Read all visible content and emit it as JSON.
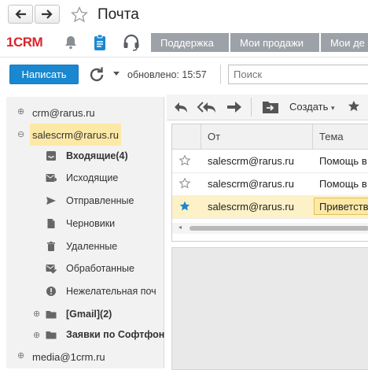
{
  "window": {
    "title": "Почта"
  },
  "menu": {
    "tabs": [
      "Поддержка",
      "Мои продажи",
      "Мои де"
    ]
  },
  "toolbar": {
    "compose_label": "Написать",
    "updated_label": "обновлено: 15:57",
    "search_placeholder": "Поиск"
  },
  "logo": {
    "text": "1CRM"
  },
  "sidebar": {
    "accounts": [
      {
        "label": "crm@rarus.ru"
      },
      {
        "label": "salescrm@rarus.ru"
      },
      {
        "label": "media@1crm.ru"
      }
    ],
    "folders": [
      {
        "label": "Входящие(4)",
        "icon": "inbox-icon",
        "bold": true
      },
      {
        "label": "Исходящие",
        "icon": "outbox-icon"
      },
      {
        "label": "Отправленные",
        "icon": "send-icon"
      },
      {
        "label": "Черновики",
        "icon": "draft-icon"
      },
      {
        "label": "Удаленные",
        "icon": "trash-icon"
      },
      {
        "label": "Обработанные",
        "icon": "processed-icon"
      },
      {
        "label": "Нежелательная поч",
        "icon": "spam-icon"
      },
      {
        "label": "[Gmail](2)",
        "icon": "folder-icon",
        "bold": true
      },
      {
        "label": "Заявки по Софтфон",
        "icon": "folder-icon",
        "bold": true
      }
    ]
  },
  "mail_toolbar": {
    "create_label": "Создать"
  },
  "grid": {
    "columns": {
      "from": "От",
      "subject": "Тема"
    },
    "rows": [
      {
        "from": "salescrm@rarus.ru",
        "subject": "Помощь в",
        "starred": false,
        "selected": false
      },
      {
        "from": "salescrm@rarus.ru",
        "subject": "Помощь в",
        "starred": false,
        "selected": false
      },
      {
        "from": "salescrm@rarus.ru",
        "subject": "Приветству",
        "starred": true,
        "selected": true
      }
    ]
  },
  "colors": {
    "accent": "#1a88d0",
    "selected_account_bg": "#fde9a6",
    "selected_row_bg": "#fdf1c8",
    "menu_tab_bg": "#9da1a8",
    "logo_red": "#d7262b"
  }
}
